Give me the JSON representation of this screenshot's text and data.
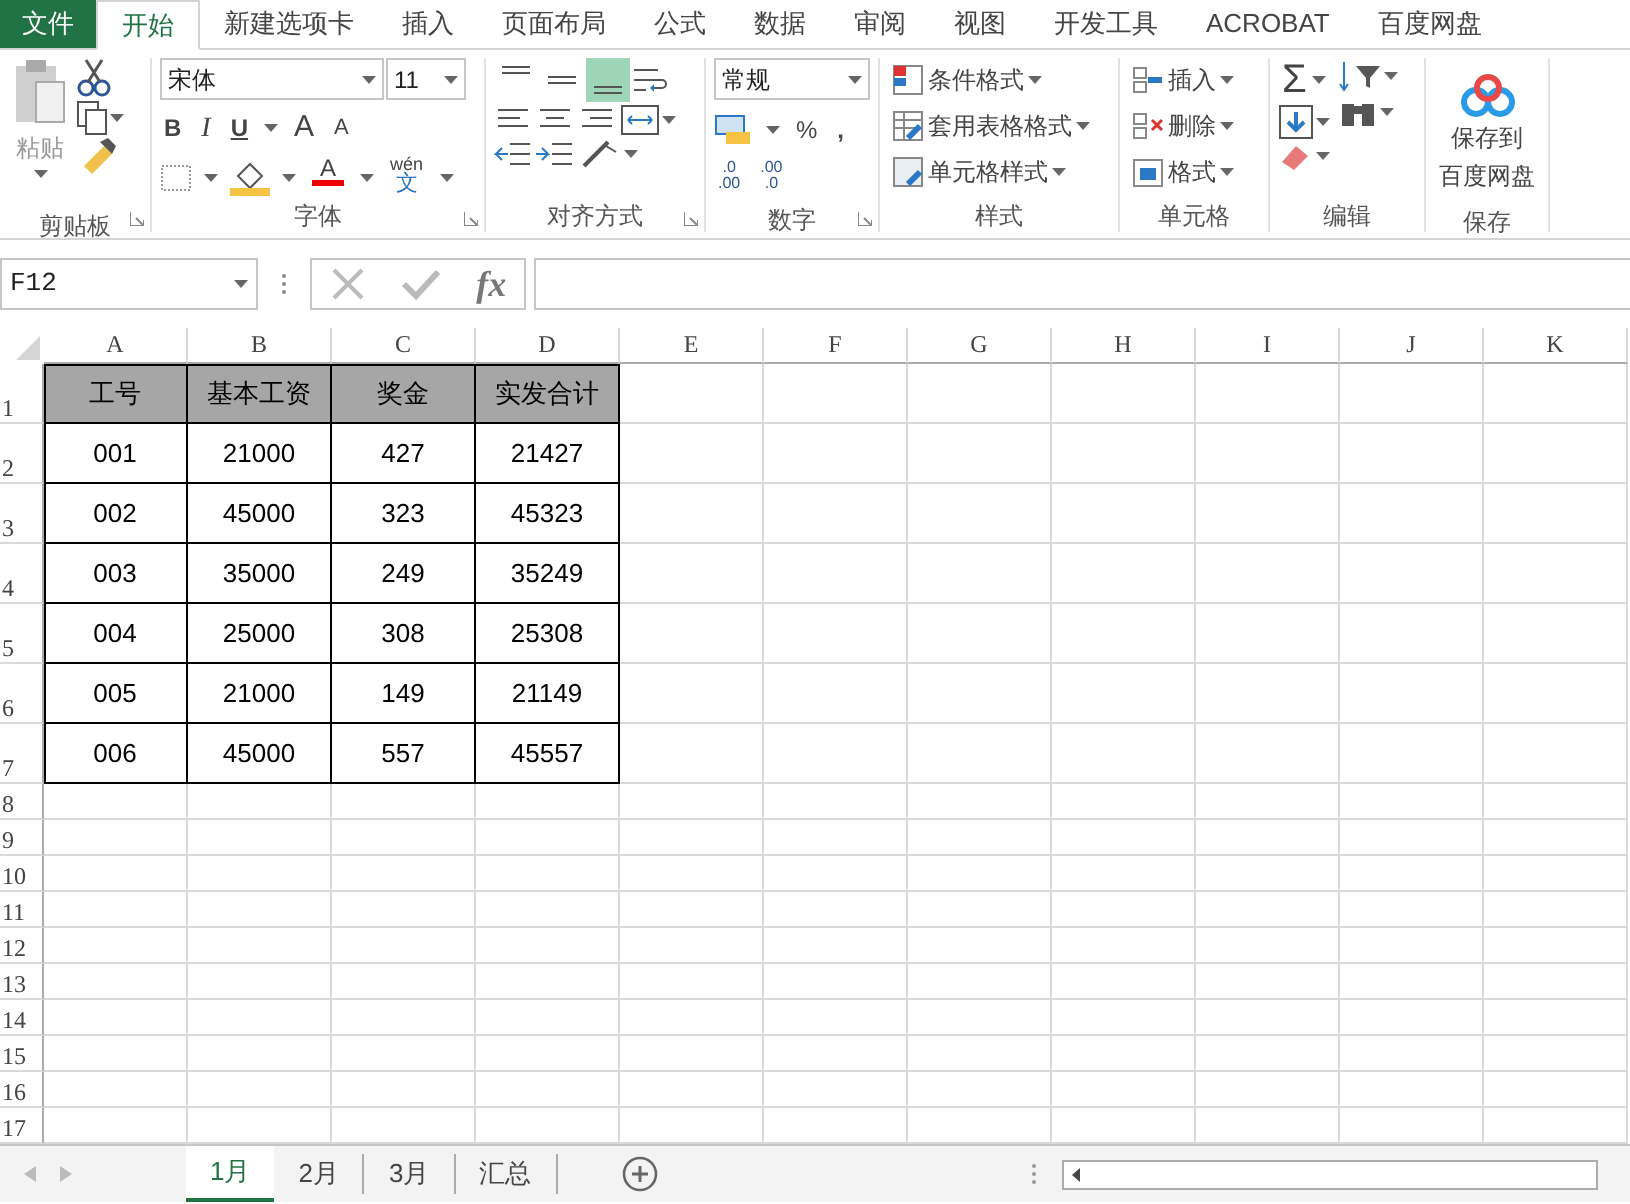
{
  "menu_tabs": [
    {
      "label": "文件",
      "kind": "file",
      "selected": false
    },
    {
      "label": "开始",
      "kind": "tab",
      "selected": true
    },
    {
      "label": "新建选项卡",
      "kind": "tab",
      "selected": false
    },
    {
      "label": "插入",
      "kind": "tab",
      "selected": false
    },
    {
      "label": "页面布局",
      "kind": "tab",
      "selected": false
    },
    {
      "label": "公式",
      "kind": "tab",
      "selected": false
    },
    {
      "label": "数据",
      "kind": "tab",
      "selected": false
    },
    {
      "label": "审阅",
      "kind": "tab",
      "selected": false
    },
    {
      "label": "视图",
      "kind": "tab",
      "selected": false
    },
    {
      "label": "开发工具",
      "kind": "tab",
      "selected": false
    },
    {
      "label": "ACROBAT",
      "kind": "tab",
      "selected": false
    },
    {
      "label": "百度网盘",
      "kind": "tab",
      "selected": false
    }
  ],
  "ribbon": {
    "clipboard": {
      "paste": "粘贴",
      "label": "剪贴板"
    },
    "font": {
      "font_name": "宋体",
      "font_size": "11",
      "bold": "B",
      "italic": "I",
      "underline": "U",
      "grow": "A",
      "shrink": "A",
      "font_color": "A",
      "phonetic_top": "wén",
      "phonetic_bottom": "文",
      "label": "字体"
    },
    "alignment": {
      "vertical": [
        {
          "kind": "top",
          "selected": false
        },
        {
          "kind": "middle",
          "selected": false
        },
        {
          "kind": "bottom",
          "selected": true
        }
      ],
      "label": "对齐方式"
    },
    "number": {
      "format": "常规",
      "percent": "%",
      "comma": ",",
      "increase_decimal": [
        ".0",
        ".00"
      ],
      "decrease_decimal": [
        ".00",
        ".0"
      ],
      "label": "数字"
    },
    "styles": {
      "items": [
        "条件格式",
        "套用表格格式",
        "单元格样式"
      ],
      "label": "样式"
    },
    "cells": {
      "items": [
        "插入",
        "删除",
        "格式"
      ],
      "label": "单元格"
    },
    "editing": {
      "sum": "Σ",
      "label": "编辑"
    },
    "save": {
      "button": [
        "保存到",
        "百度网盘"
      ],
      "label": "保存"
    }
  },
  "name_box": "F12",
  "function_label": "fx",
  "sheet": {
    "columns": [
      "A",
      "B",
      "C",
      "D",
      "E",
      "F",
      "G",
      "H",
      "I",
      "J",
      "K"
    ],
    "row_numbers": [
      "1",
      "2",
      "3",
      "4",
      "5",
      "6",
      "7",
      "8",
      "9",
      "10",
      "11",
      "12",
      "13",
      "14",
      "15",
      "16",
      "17"
    ],
    "header": [
      "工号",
      "基本工资",
      "奖金",
      "实发合计"
    ],
    "rows": [
      [
        "001",
        "21000",
        "427",
        "21427"
      ],
      [
        "002",
        "45000",
        "323",
        "45323"
      ],
      [
        "003",
        "35000",
        "249",
        "35249"
      ],
      [
        "004",
        "25000",
        "308",
        "25308"
      ],
      [
        "005",
        "21000",
        "149",
        "21149"
      ],
      [
        "006",
        "45000",
        "557",
        "45557"
      ]
    ]
  },
  "sheet_tabs": [
    {
      "label": "1月",
      "selected": true
    },
    {
      "label": "2月",
      "selected": false
    },
    {
      "label": "3月",
      "selected": false
    },
    {
      "label": "汇总",
      "selected": false
    }
  ]
}
